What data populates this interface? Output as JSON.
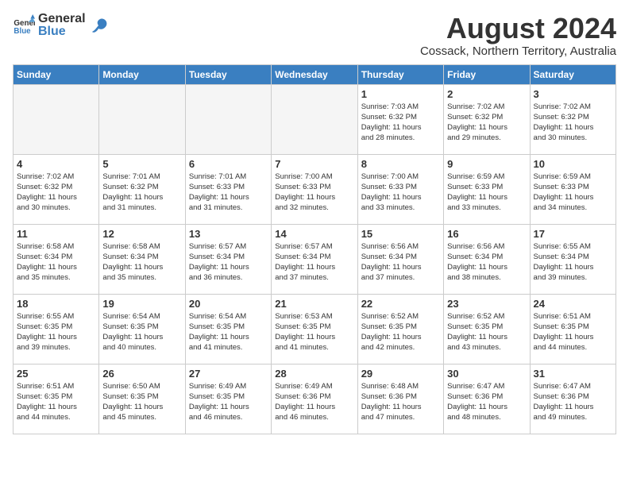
{
  "header": {
    "logo_general": "General",
    "logo_blue": "Blue",
    "title": "August 2024",
    "subtitle": "Cossack, Northern Territory, Australia"
  },
  "calendar": {
    "days_of_week": [
      "Sunday",
      "Monday",
      "Tuesday",
      "Wednesday",
      "Thursday",
      "Friday",
      "Saturday"
    ],
    "weeks": [
      [
        {
          "day": "",
          "detail": ""
        },
        {
          "day": "",
          "detail": ""
        },
        {
          "day": "",
          "detail": ""
        },
        {
          "day": "",
          "detail": ""
        },
        {
          "day": "1",
          "detail": "Sunrise: 7:03 AM\nSunset: 6:32 PM\nDaylight: 11 hours\nand 28 minutes."
        },
        {
          "day": "2",
          "detail": "Sunrise: 7:02 AM\nSunset: 6:32 PM\nDaylight: 11 hours\nand 29 minutes."
        },
        {
          "day": "3",
          "detail": "Sunrise: 7:02 AM\nSunset: 6:32 PM\nDaylight: 11 hours\nand 30 minutes."
        }
      ],
      [
        {
          "day": "4",
          "detail": "Sunrise: 7:02 AM\nSunset: 6:32 PM\nDaylight: 11 hours\nand 30 minutes."
        },
        {
          "day": "5",
          "detail": "Sunrise: 7:01 AM\nSunset: 6:32 PM\nDaylight: 11 hours\nand 31 minutes."
        },
        {
          "day": "6",
          "detail": "Sunrise: 7:01 AM\nSunset: 6:33 PM\nDaylight: 11 hours\nand 31 minutes."
        },
        {
          "day": "7",
          "detail": "Sunrise: 7:00 AM\nSunset: 6:33 PM\nDaylight: 11 hours\nand 32 minutes."
        },
        {
          "day": "8",
          "detail": "Sunrise: 7:00 AM\nSunset: 6:33 PM\nDaylight: 11 hours\nand 33 minutes."
        },
        {
          "day": "9",
          "detail": "Sunrise: 6:59 AM\nSunset: 6:33 PM\nDaylight: 11 hours\nand 33 minutes."
        },
        {
          "day": "10",
          "detail": "Sunrise: 6:59 AM\nSunset: 6:33 PM\nDaylight: 11 hours\nand 34 minutes."
        }
      ],
      [
        {
          "day": "11",
          "detail": "Sunrise: 6:58 AM\nSunset: 6:34 PM\nDaylight: 11 hours\nand 35 minutes."
        },
        {
          "day": "12",
          "detail": "Sunrise: 6:58 AM\nSunset: 6:34 PM\nDaylight: 11 hours\nand 35 minutes."
        },
        {
          "day": "13",
          "detail": "Sunrise: 6:57 AM\nSunset: 6:34 PM\nDaylight: 11 hours\nand 36 minutes."
        },
        {
          "day": "14",
          "detail": "Sunrise: 6:57 AM\nSunset: 6:34 PM\nDaylight: 11 hours\nand 37 minutes."
        },
        {
          "day": "15",
          "detail": "Sunrise: 6:56 AM\nSunset: 6:34 PM\nDaylight: 11 hours\nand 37 minutes."
        },
        {
          "day": "16",
          "detail": "Sunrise: 6:56 AM\nSunset: 6:34 PM\nDaylight: 11 hours\nand 38 minutes."
        },
        {
          "day": "17",
          "detail": "Sunrise: 6:55 AM\nSunset: 6:34 PM\nDaylight: 11 hours\nand 39 minutes."
        }
      ],
      [
        {
          "day": "18",
          "detail": "Sunrise: 6:55 AM\nSunset: 6:35 PM\nDaylight: 11 hours\nand 39 minutes."
        },
        {
          "day": "19",
          "detail": "Sunrise: 6:54 AM\nSunset: 6:35 PM\nDaylight: 11 hours\nand 40 minutes."
        },
        {
          "day": "20",
          "detail": "Sunrise: 6:54 AM\nSunset: 6:35 PM\nDaylight: 11 hours\nand 41 minutes."
        },
        {
          "day": "21",
          "detail": "Sunrise: 6:53 AM\nSunset: 6:35 PM\nDaylight: 11 hours\nand 41 minutes."
        },
        {
          "day": "22",
          "detail": "Sunrise: 6:52 AM\nSunset: 6:35 PM\nDaylight: 11 hours\nand 42 minutes."
        },
        {
          "day": "23",
          "detail": "Sunrise: 6:52 AM\nSunset: 6:35 PM\nDaylight: 11 hours\nand 43 minutes."
        },
        {
          "day": "24",
          "detail": "Sunrise: 6:51 AM\nSunset: 6:35 PM\nDaylight: 11 hours\nand 44 minutes."
        }
      ],
      [
        {
          "day": "25",
          "detail": "Sunrise: 6:51 AM\nSunset: 6:35 PM\nDaylight: 11 hours\nand 44 minutes."
        },
        {
          "day": "26",
          "detail": "Sunrise: 6:50 AM\nSunset: 6:35 PM\nDaylight: 11 hours\nand 45 minutes."
        },
        {
          "day": "27",
          "detail": "Sunrise: 6:49 AM\nSunset: 6:35 PM\nDaylight: 11 hours\nand 46 minutes."
        },
        {
          "day": "28",
          "detail": "Sunrise: 6:49 AM\nSunset: 6:36 PM\nDaylight: 11 hours\nand 46 minutes."
        },
        {
          "day": "29",
          "detail": "Sunrise: 6:48 AM\nSunset: 6:36 PM\nDaylight: 11 hours\nand 47 minutes."
        },
        {
          "day": "30",
          "detail": "Sunrise: 6:47 AM\nSunset: 6:36 PM\nDaylight: 11 hours\nand 48 minutes."
        },
        {
          "day": "31",
          "detail": "Sunrise: 6:47 AM\nSunset: 6:36 PM\nDaylight: 11 hours\nand 49 minutes."
        }
      ]
    ]
  }
}
